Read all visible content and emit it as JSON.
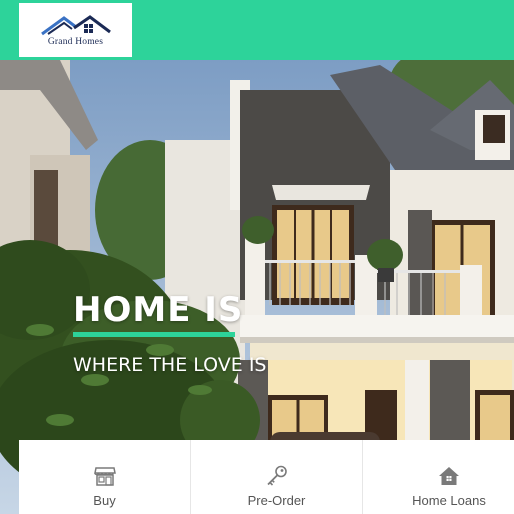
{
  "header": {
    "logo_text": "Grand Homes",
    "accent_color": "#2dd39a",
    "logo_icon": "house-roof-logo-icon"
  },
  "hero": {
    "title": "HOME IS",
    "subtitle": "WHERE THE LOVE IS",
    "background": "modern-two-storey-house-photo"
  },
  "services": [
    {
      "label": "Buy",
      "icon": "storefront-icon"
    },
    {
      "label": "Pre-Order",
      "icon": "key-icon"
    },
    {
      "label": "Home Loans",
      "icon": "home-icon"
    }
  ]
}
